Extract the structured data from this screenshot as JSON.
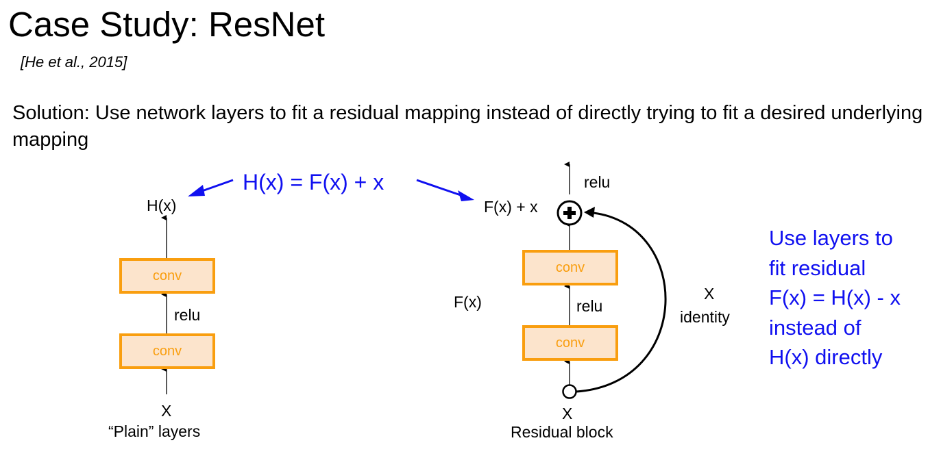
{
  "slide": {
    "title": "Case Study: ResNet",
    "citation": "[He et al., 2015]",
    "solution_text": "Solution: Use network layers to fit a residual mapping instead of directly trying to fit a desired underlying mapping"
  },
  "equation": {
    "text": "H(x) = F(x) + x",
    "color": "#1010f0"
  },
  "plain_block": {
    "output_label": "H(x)",
    "top_conv_label": "conv",
    "relu_label": "relu",
    "bottom_conv_label": "conv",
    "input_label": "X",
    "caption": "“Plain” layers"
  },
  "residual_block": {
    "output_relu_label": "relu",
    "sum_label": "F(x) + x",
    "fx_label": "F(x)",
    "top_conv_label": "conv",
    "relu_label": "relu",
    "bottom_conv_label": "conv",
    "input_label": "X",
    "identity_x_label": "X",
    "identity_label": "identity",
    "caption": "Residual block"
  },
  "side_note": {
    "lines": [
      "Use layers to",
      "fit residual",
      "F(x) = H(x) - x",
      "instead of",
      "H(x) directly"
    ]
  },
  "colors": {
    "conv_fill": "#fce4cc",
    "conv_border": "#f99e0f",
    "accent_blue": "#1010f0"
  }
}
